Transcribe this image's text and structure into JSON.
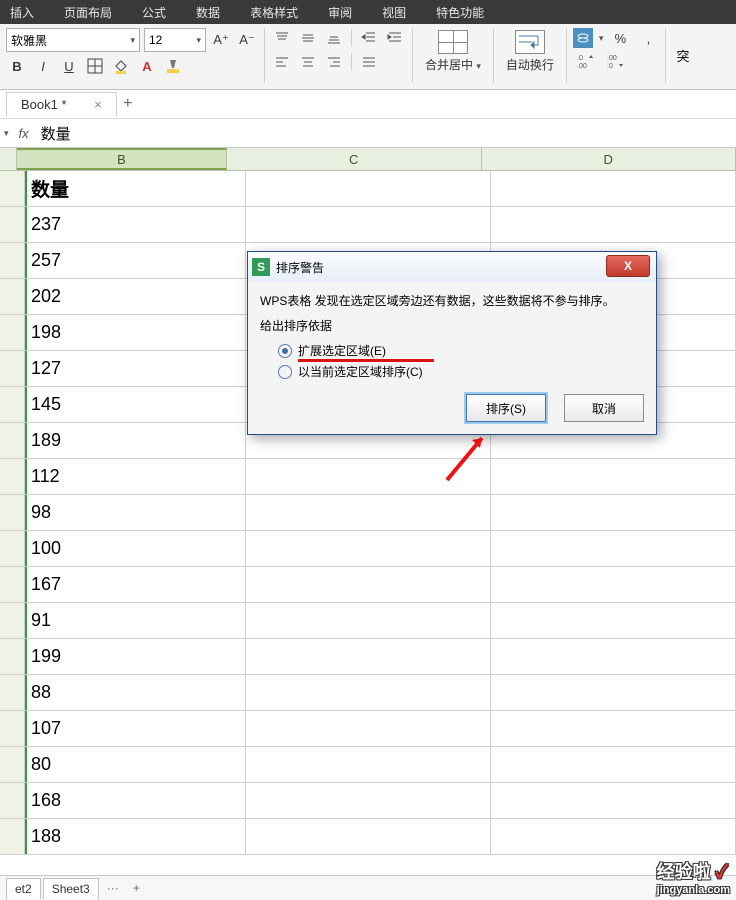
{
  "menu": {
    "m1": "插入",
    "m2": "页面布局",
    "m3": "公式",
    "m4": "数据",
    "m5": "表格样式",
    "m6": "审阅",
    "m7": "视图",
    "m8": "特色功能"
  },
  "ribbon": {
    "fontName": "软雅黑",
    "fontSize": "12",
    "increaseFont": "A⁺",
    "decreaseFont": "A⁻",
    "merge": "合并居中",
    "wrap": "自动换行",
    "pct": "%",
    "comma": ",",
    "dec1": ".0",
    "dec2": ".00",
    "overflow": "突"
  },
  "book": {
    "tab": "Book1 *",
    "closeGlyph": "×",
    "add": "+"
  },
  "fbar": {
    "fx": "fx",
    "value": "数量",
    "downGlyph": "▾"
  },
  "cols": {
    "B": "B",
    "C": "C",
    "D": "D"
  },
  "data_header": "数量",
  "data_values": [
    "237",
    "257",
    "202",
    "198",
    "127",
    "145",
    "189",
    "112",
    "98",
    "100",
    "167",
    "91",
    "199",
    "88",
    "107",
    "80",
    "168",
    "188"
  ],
  "dialog": {
    "title": "排序警告",
    "line1": "WPS表格 发现在选定区域旁边还有数据，这些数据将不参与排序。",
    "line2": "给出排序依据",
    "opt1": "扩展选定区域(E)",
    "opt2": "以当前选定区域排序(C)",
    "sort": "排序(S)",
    "cancel": "取消",
    "closeX": "X",
    "logo": "S"
  },
  "sheets": {
    "s2": "et2",
    "s3": "Sheet3",
    "dots": "···",
    "plus": "+"
  },
  "wm": {
    "main": "经验啦",
    "check": "✓",
    "sub": "jingyanla.com"
  }
}
